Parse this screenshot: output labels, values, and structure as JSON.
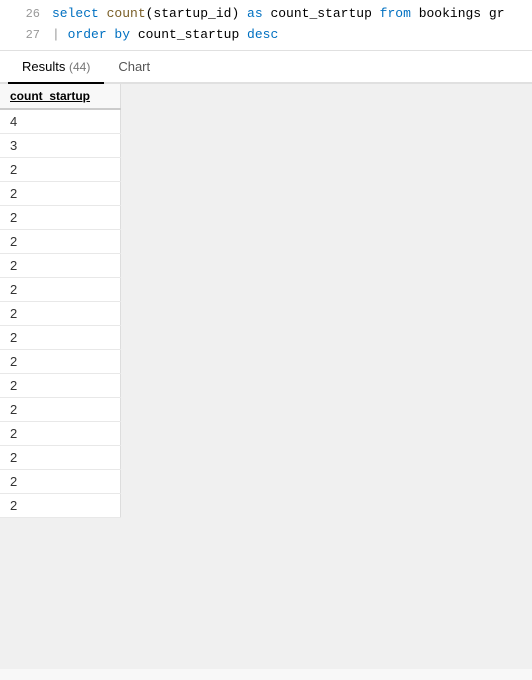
{
  "code": {
    "lines": [
      {
        "number": "26",
        "tokens": [
          {
            "text": "select ",
            "class": "kw-blue"
          },
          {
            "text": "count",
            "class": "kw-fn"
          },
          {
            "text": "(startup_id) ",
            "class": "kw-plain"
          },
          {
            "text": "as ",
            "class": "kw-blue"
          },
          {
            "text": "count_startup ",
            "class": "kw-plain"
          },
          {
            "text": "from ",
            "class": "kw-blue"
          },
          {
            "text": "bookings",
            "class": "kw-plain"
          },
          {
            "text": "  gr",
            "class": "kw-plain"
          }
        ]
      },
      {
        "number": "27",
        "tokens": [
          {
            "text": "order ",
            "class": "kw-blue"
          },
          {
            "text": "by ",
            "class": "kw-blue"
          },
          {
            "text": "count_startup ",
            "class": "kw-plain"
          },
          {
            "text": "desc",
            "class": "kw-blue"
          }
        ]
      }
    ]
  },
  "tabs": {
    "results": {
      "label": "Results",
      "count": "(44)",
      "active": true
    },
    "chart": {
      "label": "Chart",
      "active": false
    }
  },
  "table": {
    "columns": [
      "count_startup"
    ],
    "rows": [
      4,
      3,
      2,
      2,
      2,
      2,
      2,
      2,
      2,
      2,
      2,
      2,
      2,
      2,
      2,
      2,
      2
    ]
  }
}
